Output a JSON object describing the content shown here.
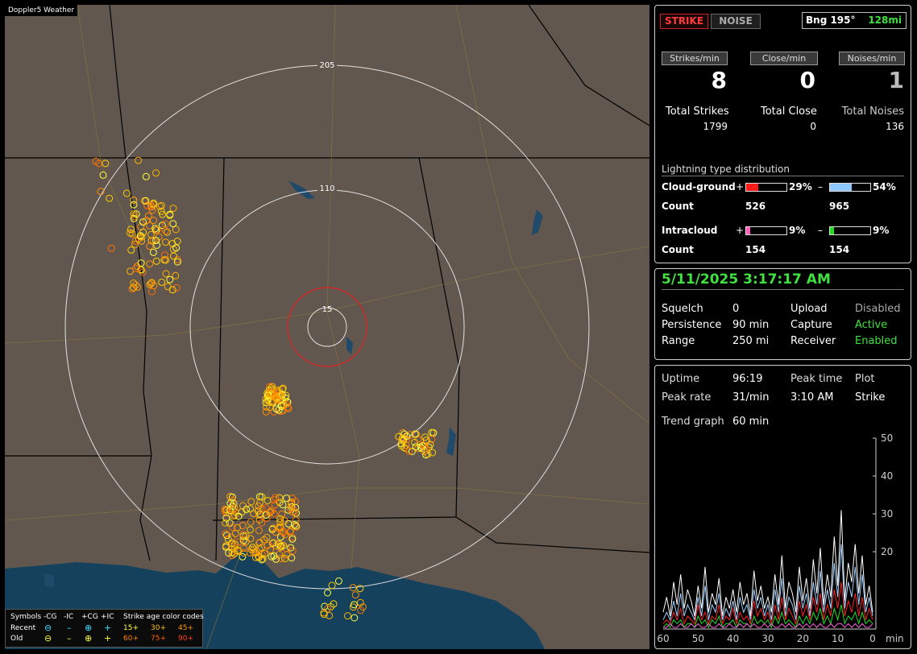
{
  "app_title": "Doppler5 Weather",
  "map": {
    "range_rings": [
      "205",
      "110",
      "15"
    ],
    "legend": {
      "symbols_label": "Symbols",
      "col_neg_cg": "-CG",
      "col_neg_ic": "-IC",
      "col_pos_cg": "+CG",
      "col_pos_ic": "+IC",
      "age_codes_label": "Strike age color codes",
      "recent_label": "Recent",
      "old_label": "Old",
      "recent_codes": [
        "15+",
        "30+",
        "45+"
      ],
      "old_codes": [
        "60+",
        "75+",
        "90+"
      ]
    }
  },
  "panel_top": {
    "strike_button": "STRIKE",
    "noise_button": "NOISE",
    "bearing": "Bng 195°",
    "distance": "128mi",
    "strikes_per_min_label": "Strikes/min",
    "close_per_min_label": "Close/min",
    "noises_per_min_label": "Noises/min",
    "strikes_per_min": "8",
    "close_per_min": "0",
    "noises_per_min": "1",
    "total_strikes_label": "Total Strikes",
    "total_close_label": "Total Close",
    "total_noises_label": "Total Noises",
    "total_strikes": "1799",
    "total_close": "0",
    "total_noises": "136",
    "distribution_title": "Lightning type distribution",
    "cg_label": "Cloud-ground",
    "ic_label": "Intracloud",
    "count_label": "Count",
    "plus": "+",
    "minus": "–",
    "cg_pos_pct": "29%",
    "cg_neg_pct": "54%",
    "cg_pos_count": "526",
    "cg_neg_count": "965",
    "ic_pos_pct": "9%",
    "ic_neg_pct": "9%",
    "ic_pos_count": "154",
    "ic_neg_count": "154",
    "cg_pos_fraction": 0.29,
    "cg_neg_fraction": 0.54,
    "ic_pos_fraction": 0.09,
    "ic_neg_fraction": 0.09
  },
  "panel_status": {
    "datetime": "5/11/2025 3:17:17 AM",
    "squelch_label": "Squelch",
    "squelch": "0",
    "persistence_label": "Persistence",
    "persistence": "90 min",
    "range_label": "Range",
    "range": "250 mi",
    "upload_label": "Upload",
    "upload": "Disabled",
    "capture_label": "Capture",
    "capture": "Active",
    "receiver_label": "Receiver",
    "receiver": "Enabled"
  },
  "panel_graph": {
    "uptime_label": "Uptime",
    "uptime": "96:19",
    "peak_time_label": "Peak time",
    "peak_time": "3:10 AM",
    "plot_label": "Plot",
    "peak_rate_label": "Peak rate",
    "peak_rate": "31/min",
    "plot_value": "Strike",
    "trend_label": "Trend graph",
    "trend_value": "60 min"
  },
  "chart_data": {
    "type": "line",
    "x": [
      60,
      59,
      58,
      57,
      56,
      55,
      54,
      53,
      52,
      51,
      50,
      49,
      48,
      47,
      46,
      45,
      44,
      43,
      42,
      41,
      40,
      39,
      38,
      37,
      36,
      35,
      34,
      33,
      32,
      31,
      30,
      29,
      28,
      27,
      26,
      25,
      24,
      23,
      22,
      21,
      20,
      19,
      18,
      17,
      16,
      15,
      14,
      13,
      12,
      11,
      10,
      9,
      8,
      7,
      6,
      5,
      4,
      3,
      2,
      1,
      0
    ],
    "xticks": [
      "60",
      "50",
      "40",
      "30",
      "20",
      "10",
      "0"
    ],
    "x_unit": "min",
    "yticks": [
      "50",
      "40",
      "30",
      "20"
    ],
    "ylim": [
      0,
      50
    ],
    "series": [
      {
        "color": "#ffffff",
        "values": [
          4,
          8,
          3,
          12,
          6,
          14,
          5,
          10,
          7,
          3,
          11,
          5,
          16,
          4,
          9,
          6,
          13,
          3,
          8,
          5,
          10,
          4,
          12,
          6,
          9,
          3,
          15,
          7,
          11,
          5,
          8,
          4,
          14,
          6,
          19,
          5,
          12,
          9,
          4,
          16,
          7,
          13,
          5,
          18,
          9,
          21,
          6,
          14,
          8,
          24,
          11,
          31,
          7,
          17,
          12,
          22,
          9,
          19,
          6,
          11,
          4
        ]
      },
      {
        "color": "#9fd0ff",
        "values": [
          2,
          4,
          2,
          7,
          3,
          9,
          3,
          6,
          4,
          2,
          8,
          3,
          11,
          2,
          6,
          4,
          9,
          2,
          5,
          3,
          7,
          2,
          8,
          4,
          6,
          2,
          10,
          5,
          8,
          3,
          6,
          2,
          10,
          4,
          13,
          3,
          8,
          6,
          2,
          11,
          5,
          9,
          3,
          12,
          6,
          15,
          4,
          10,
          5,
          17,
          8,
          22,
          5,
          12,
          8,
          16,
          6,
          14,
          4,
          8,
          3
        ]
      },
      {
        "color": "#ff2020",
        "values": [
          1,
          2,
          1,
          4,
          2,
          5,
          1,
          3,
          2,
          1,
          6,
          2,
          4,
          1,
          3,
          2,
          6,
          1,
          3,
          2,
          5,
          1,
          4,
          2,
          3,
          1,
          7,
          3,
          5,
          2,
          4,
          1,
          6,
          2,
          8,
          2,
          5,
          3,
          1,
          7,
          3,
          6,
          2,
          8,
          4,
          9,
          2,
          6,
          3,
          10,
          5,
          12,
          3,
          7,
          4,
          9,
          3,
          8,
          2,
          5,
          2
        ]
      },
      {
        "color": "#20e020",
        "values": [
          0,
          1,
          0,
          2,
          1,
          2,
          0,
          1,
          1,
          0,
          3,
          1,
          2,
          0,
          2,
          1,
          3,
          0,
          1,
          1,
          2,
          0,
          2,
          1,
          1,
          0,
          3,
          1,
          2,
          1,
          2,
          0,
          3,
          1,
          4,
          1,
          2,
          1,
          0,
          3,
          1,
          3,
          1,
          4,
          2,
          5,
          1,
          3,
          1,
          5,
          2,
          6,
          1,
          3,
          2,
          4,
          1,
          4,
          1,
          2,
          1
        ]
      },
      {
        "color": "#ff60e0",
        "values": [
          0,
          0,
          1,
          0,
          0,
          1,
          0,
          0,
          1,
          0,
          1,
          0,
          0,
          1,
          0,
          0,
          1,
          0,
          0,
          1,
          0,
          0,
          1,
          0,
          1,
          0,
          1,
          0,
          0,
          1,
          0,
          1,
          0,
          0,
          1,
          0,
          1,
          0,
          0,
          1,
          0,
          1,
          0,
          1,
          0,
          1,
          0,
          0,
          1,
          0,
          1,
          1,
          0,
          1,
          0,
          1,
          0,
          1,
          0,
          0,
          1
        ]
      }
    ]
  }
}
